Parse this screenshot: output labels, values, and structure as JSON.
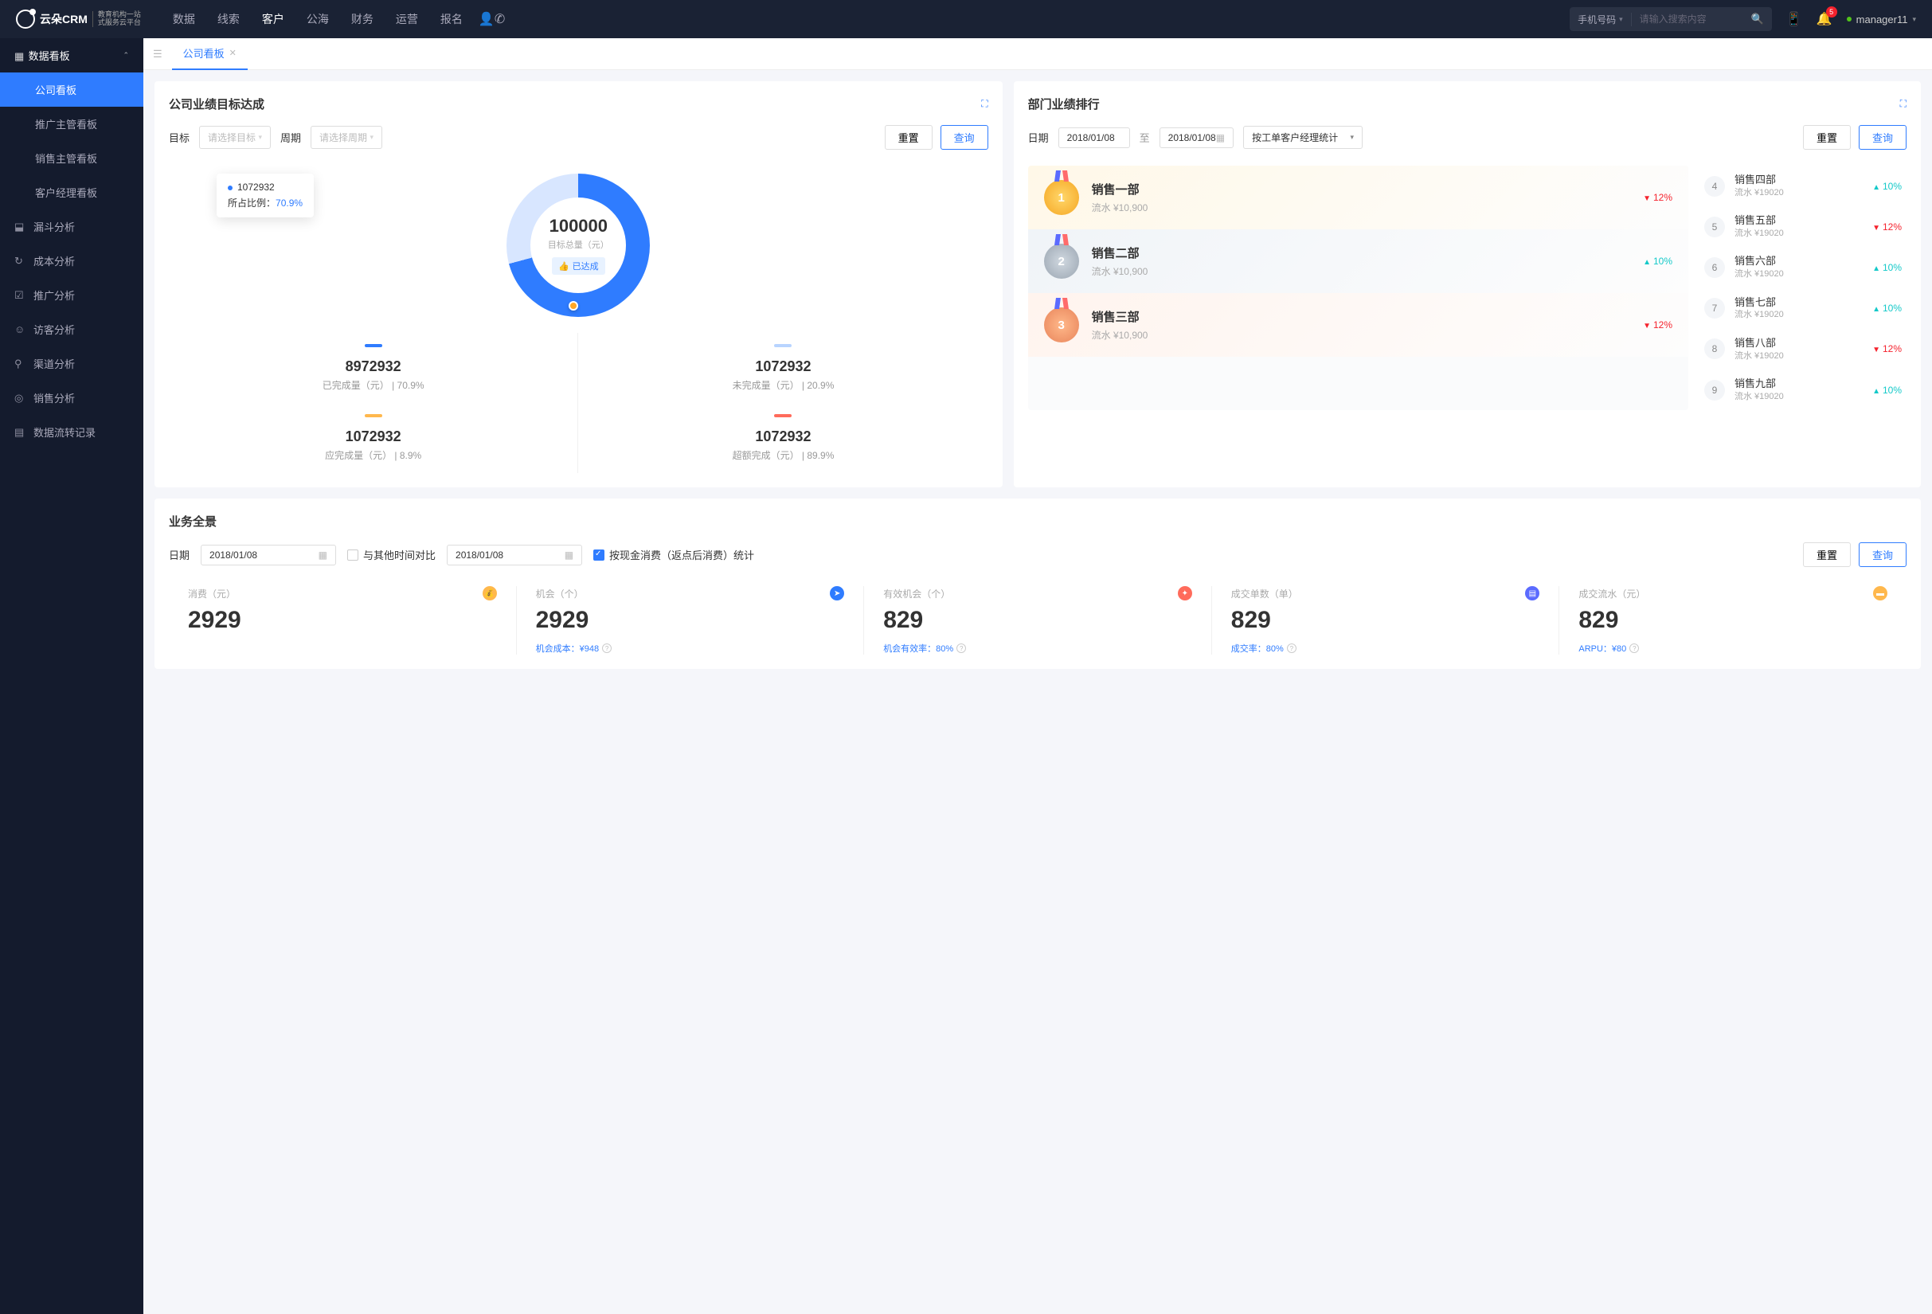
{
  "brand": {
    "main": "云朵CRM",
    "sub1": "教育机构一站",
    "sub2": "式服务云平台"
  },
  "topnav": [
    "数据",
    "线索",
    "客户",
    "公海",
    "财务",
    "运营",
    "报名"
  ],
  "topnav_active": 2,
  "search": {
    "type": "手机号码",
    "placeholder": "请输入搜索内容"
  },
  "notif_count": "5",
  "user": "manager11",
  "sidebar": {
    "header": "数据看板",
    "subs": [
      "公司看板",
      "推广主管看板",
      "销售主管看板",
      "客户经理看板"
    ],
    "active": 0,
    "items": [
      "漏斗分析",
      "成本分析",
      "推广分析",
      "访客分析",
      "渠道分析",
      "销售分析",
      "数据流转记录"
    ],
    "icons": [
      "⬓",
      "↻",
      "☑",
      "☺",
      "⚲",
      "◎",
      "▤"
    ]
  },
  "tab": {
    "label": "公司看板"
  },
  "panel_goal": {
    "title": "公司业绩目标达成",
    "lbl_target": "目标",
    "ph_target": "请选择目标",
    "lbl_period": "周期",
    "ph_period": "请选择周期",
    "btn_reset": "重置",
    "btn_query": "查询",
    "tooltip_val": "1072932",
    "tooltip_lbl": "所占比例：",
    "tooltip_pct": "70.9%",
    "center_val": "100000",
    "center_lbl": "目标总量（元）",
    "badge": "已达成",
    "cells": [
      {
        "bar": "#2f7cff",
        "val": "8972932",
        "lbl": "已完成量（元）  |  70.9%"
      },
      {
        "bar": "#b8d4ff",
        "val": "1072932",
        "lbl": "未完成量（元）  |  20.9%"
      },
      {
        "bar": "#ffb84d",
        "val": "1072932",
        "lbl": "应完成量（元）  |  8.9%"
      },
      {
        "bar": "#ff6b5b",
        "val": "1072932",
        "lbl": "超额完成（元）  |  89.9%"
      }
    ]
  },
  "panel_rank": {
    "title": "部门业绩排行",
    "lbl_date": "日期",
    "date_from": "2018/01/08",
    "date_sep": "至",
    "date_to": "2018/01/08",
    "stat_sel": "按工单客户经理统计",
    "btn_reset": "重置",
    "btn_query": "查询",
    "top3": [
      {
        "rank": "1",
        "name": "销售一部",
        "sub": "流水 ¥10,900",
        "pct": "12%",
        "dir": "down"
      },
      {
        "rank": "2",
        "name": "销售二部",
        "sub": "流水 ¥10,900",
        "pct": "10%",
        "dir": "up"
      },
      {
        "rank": "3",
        "name": "销售三部",
        "sub": "流水 ¥10,900",
        "pct": "12%",
        "dir": "down"
      }
    ],
    "rest": [
      {
        "n": "4",
        "name": "销售四部",
        "sub": "流水 ¥19020",
        "pct": "10%",
        "dir": "up"
      },
      {
        "n": "5",
        "name": "销售五部",
        "sub": "流水 ¥19020",
        "pct": "12%",
        "dir": "down"
      },
      {
        "n": "6",
        "name": "销售六部",
        "sub": "流水 ¥19020",
        "pct": "10%",
        "dir": "up"
      },
      {
        "n": "7",
        "name": "销售七部",
        "sub": "流水 ¥19020",
        "pct": "10%",
        "dir": "up"
      },
      {
        "n": "8",
        "name": "销售八部",
        "sub": "流水 ¥19020",
        "pct": "12%",
        "dir": "down"
      },
      {
        "n": "9",
        "name": "销售九部",
        "sub": "流水 ¥19020",
        "pct": "10%",
        "dir": "up"
      }
    ]
  },
  "panel_overview": {
    "title": "业务全景",
    "lbl_date": "日期",
    "date": "2018/01/08",
    "chk_compare": "与其他时间对比",
    "date2": "2018/01/08",
    "chk_cash": "按现金消费（返点后消费）统计",
    "btn_reset": "重置",
    "btn_query": "查询",
    "kpis": [
      {
        "lbl": "消费（元）",
        "ico": "💰",
        "c": "#ffb84d",
        "val": "2929",
        "sub": ""
      },
      {
        "lbl": "机会（个）",
        "ico": "➤",
        "c": "#2f7cff",
        "val": "2929",
        "sub": "机会成本：¥948"
      },
      {
        "lbl": "有效机会（个）",
        "ico": "✦",
        "c": "#ff6b5b",
        "val": "829",
        "sub": "机会有效率：80%"
      },
      {
        "lbl": "成交单数（单）",
        "ico": "▤",
        "c": "#5b6bff",
        "val": "829",
        "sub": "成交率：80%"
      },
      {
        "lbl": "成交流水（元）",
        "ico": "▬",
        "c": "#ffb84d",
        "val": "829",
        "sub": "ARPU：¥80"
      }
    ]
  },
  "chart_data": {
    "type": "pie",
    "title": "公司业绩目标达成",
    "total": 100000,
    "series": [
      {
        "name": "已完成量",
        "value": 8972932,
        "pct": 70.9,
        "color": "#2f7cff"
      },
      {
        "name": "未完成量",
        "value": 1072932,
        "pct": 20.9,
        "color": "#b8d4ff"
      },
      {
        "name": "应完成量",
        "value": 1072932,
        "pct": 8.9,
        "color": "#ffb84d"
      },
      {
        "name": "超额完成",
        "value": 1072932,
        "pct": 89.9,
        "color": "#ff6b5b"
      }
    ]
  }
}
